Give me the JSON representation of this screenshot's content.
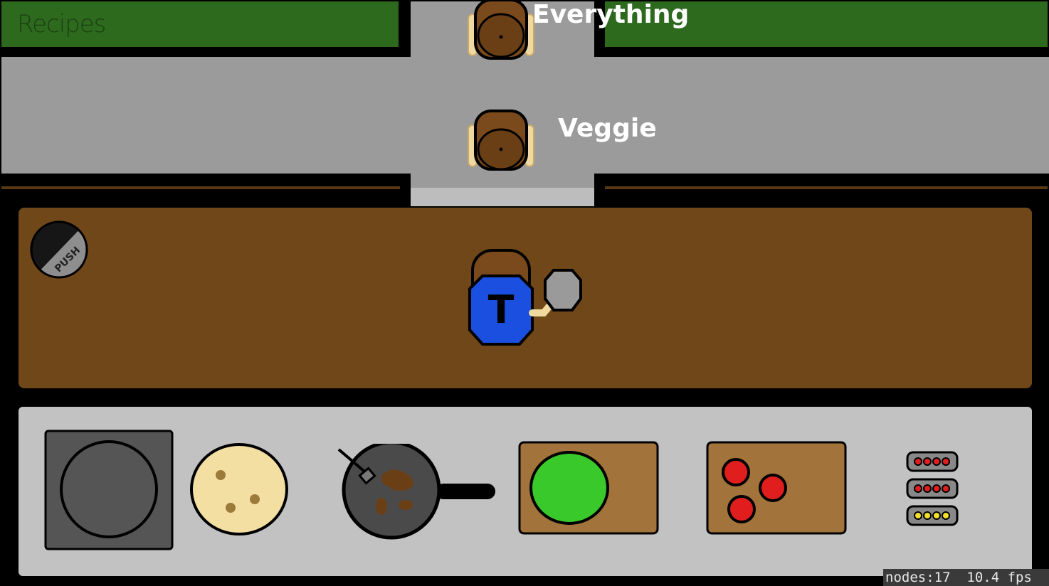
{
  "recipes_button": {
    "label": "Recipes"
  },
  "orders": [
    {
      "label": "Everything"
    },
    {
      "label": "Veggie"
    }
  ],
  "push_button": {
    "label": "PUSH"
  },
  "chef": {
    "shirt_letter": "T",
    "shirt_color": "#1a4fe0"
  },
  "stations": [
    {
      "name": "stove-burner"
    },
    {
      "name": "tortilla"
    },
    {
      "name": "frying-pan-meat"
    },
    {
      "name": "lettuce-board"
    },
    {
      "name": "tomato-board"
    },
    {
      "name": "ticket-rack"
    }
  ],
  "hud": {
    "nodes": "nodes:17",
    "fps": "10.4 fps"
  },
  "colors": {
    "grass": "#2d6a1e",
    "road": "#9b9b9b",
    "counter": "#704718",
    "shelf": "#c2c2c2",
    "text_white": "#ffffff"
  }
}
